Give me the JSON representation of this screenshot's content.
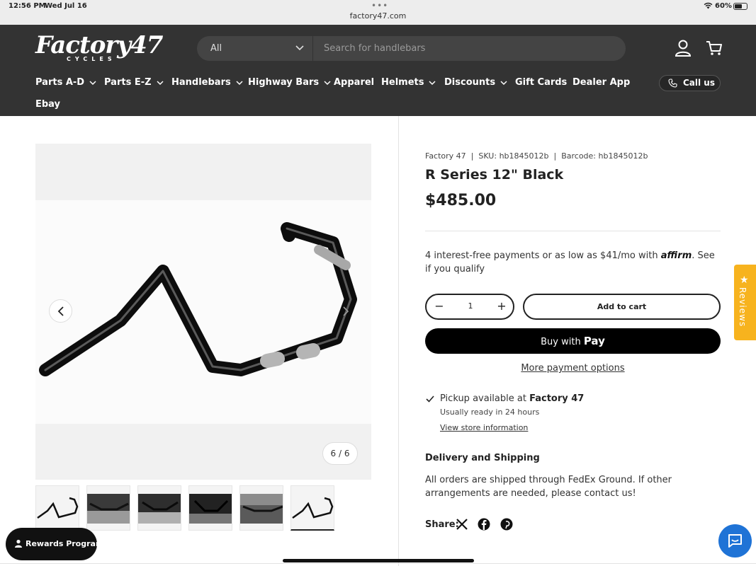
{
  "status_bar": {
    "time": "12:56 PM",
    "date": "Wed Jul 16",
    "url": "factory47.com",
    "battery": "60%"
  },
  "header": {
    "logo_text": "Factory47",
    "logo_sub": "CYCLES",
    "search_category": "All",
    "search_placeholder": "Search for handlebars",
    "nav": [
      {
        "label": "Parts A-D",
        "dropdown": true
      },
      {
        "label": "Parts E-Z",
        "dropdown": true
      },
      {
        "label": "Handlebars",
        "dropdown": true
      },
      {
        "label": "Highway Bars",
        "dropdown": true
      },
      {
        "label": "Apparel",
        "dropdown": false
      },
      {
        "label": "Helmets",
        "dropdown": true
      },
      {
        "label": "Discounts",
        "dropdown": true
      },
      {
        "label": "Gift Cards",
        "dropdown": false
      },
      {
        "label": "Dealer App",
        "dropdown": false
      }
    ],
    "nav_second_row": "Ebay",
    "call_label": "Call us"
  },
  "gallery": {
    "counter": "6 / 6",
    "thumbnail_count": 6,
    "active_thumbnail": 6
  },
  "product": {
    "vendor": "Factory 47",
    "sku_label": "SKU:",
    "sku": "hb1845012b",
    "barcode_label": "Barcode:",
    "barcode": "hb1845012b",
    "title": "R Series 12\" Black",
    "price": "$485.00",
    "affirm_pre": "4 interest-free payments or as low as $41/mo with",
    "affirm_brand": "affirm",
    "affirm_post": ". See if you qualify",
    "quantity": "1",
    "add_to_cart": "Add to cart",
    "buy_with": "Buy with",
    "apple_pay": "Pay",
    "more_payment": "More payment options",
    "pickup_pre": "Pickup available at",
    "pickup_location": "Factory 47",
    "pickup_ready": "Usually ready in 24 hours",
    "store_link": "View store information",
    "shipping_heading": "Delivery and Shipping",
    "shipping_text": "All orders are shipped through FedEx Ground. If other arrangements are needed, please contact us!",
    "share_label": "Share:"
  },
  "reviews_tab": "Reviews",
  "rewards_label": "Rewards Program",
  "colors": {
    "header_bg": "#333333",
    "reviews_tab": "#f7b31e",
    "chat": "#1f73d6"
  }
}
